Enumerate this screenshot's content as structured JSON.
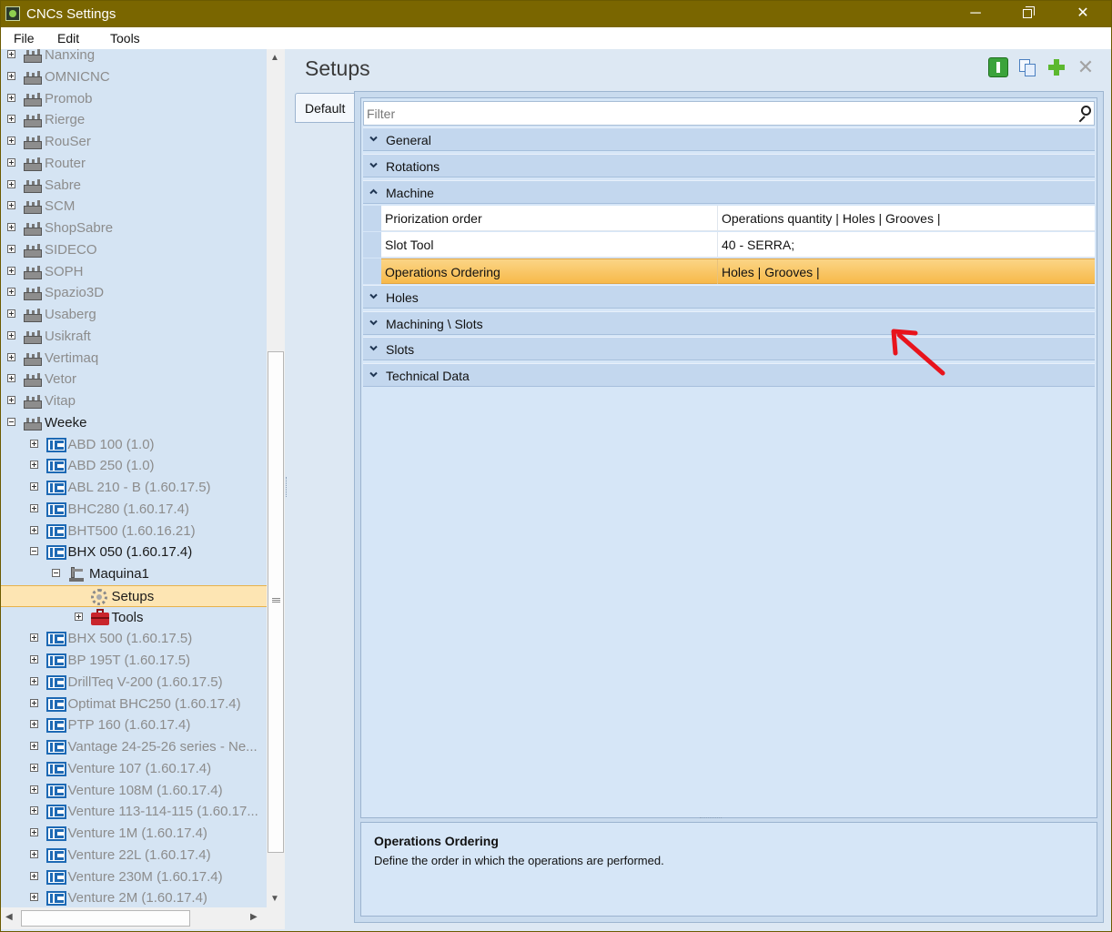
{
  "window": {
    "title": "CNCs Settings",
    "minimize": "─",
    "close": "✕"
  },
  "menu": [
    "File",
    "Edit",
    "Tools"
  ],
  "tree": [
    {
      "label": "Nanxing",
      "indent": 0,
      "icon": "factory",
      "expander": "plus",
      "style": "gray"
    },
    {
      "label": "OMNICNC",
      "indent": 0,
      "icon": "factory",
      "expander": "plus",
      "style": "gray"
    },
    {
      "label": "Promob",
      "indent": 0,
      "icon": "factory",
      "expander": "plus",
      "style": "gray"
    },
    {
      "label": "Rierge",
      "indent": 0,
      "icon": "factory",
      "expander": "plus",
      "style": "gray"
    },
    {
      "label": "RouSer",
      "indent": 0,
      "icon": "factory",
      "expander": "plus",
      "style": "gray"
    },
    {
      "label": "Router",
      "indent": 0,
      "icon": "factory",
      "expander": "plus",
      "style": "gray"
    },
    {
      "label": "Sabre",
      "indent": 0,
      "icon": "factory",
      "expander": "plus",
      "style": "gray"
    },
    {
      "label": "SCM",
      "indent": 0,
      "icon": "factory",
      "expander": "plus",
      "style": "gray"
    },
    {
      "label": "ShopSabre",
      "indent": 0,
      "icon": "factory",
      "expander": "plus",
      "style": "gray"
    },
    {
      "label": "SIDECO",
      "indent": 0,
      "icon": "factory",
      "expander": "plus",
      "style": "gray"
    },
    {
      "label": "SOPH",
      "indent": 0,
      "icon": "factory",
      "expander": "plus",
      "style": "gray"
    },
    {
      "label": "Spazio3D",
      "indent": 0,
      "icon": "factory",
      "expander": "plus",
      "style": "gray"
    },
    {
      "label": "Usaberg",
      "indent": 0,
      "icon": "factory",
      "expander": "plus",
      "style": "gray"
    },
    {
      "label": "Usikraft",
      "indent": 0,
      "icon": "factory",
      "expander": "plus",
      "style": "gray"
    },
    {
      "label": "Vertimaq",
      "indent": 0,
      "icon": "factory",
      "expander": "plus",
      "style": "gray"
    },
    {
      "label": "Vetor",
      "indent": 0,
      "icon": "factory",
      "expander": "plus",
      "style": "gray"
    },
    {
      "label": "Vitap",
      "indent": 0,
      "icon": "factory",
      "expander": "plus",
      "style": "gray"
    },
    {
      "label": "Weeke",
      "indent": 0,
      "icon": "factory",
      "expander": "minus",
      "style": "dark"
    },
    {
      "label": "ABD 100 (1.0)",
      "indent": 1,
      "icon": "hc",
      "expander": "plus",
      "style": "gray"
    },
    {
      "label": "ABD 250 (1.0)",
      "indent": 1,
      "icon": "hc",
      "expander": "plus",
      "style": "gray"
    },
    {
      "label": "ABL 210 - B (1.60.17.5)",
      "indent": 1,
      "icon": "hc",
      "expander": "plus",
      "style": "gray"
    },
    {
      "label": "BHC280 (1.60.17.4)",
      "indent": 1,
      "icon": "hc",
      "expander": "plus",
      "style": "gray"
    },
    {
      "label": "BHT500 (1.60.16.21)",
      "indent": 1,
      "icon": "hc",
      "expander": "plus",
      "style": "gray"
    },
    {
      "label": "BHX 050 (1.60.17.4)",
      "indent": 1,
      "icon": "hc",
      "expander": "minus",
      "style": "dark"
    },
    {
      "label": "Maquina1",
      "indent": 2,
      "icon": "machine",
      "expander": "minus",
      "style": "dark"
    },
    {
      "label": "Setups",
      "indent": 3,
      "icon": "gear",
      "expander": "none",
      "style": "dark",
      "selected": true
    },
    {
      "label": "Tools",
      "indent": 3,
      "icon": "toolbox",
      "expander": "plus",
      "style": "dark"
    },
    {
      "label": "BHX 500 (1.60.17.5)",
      "indent": 1,
      "icon": "hc",
      "expander": "plus",
      "style": "gray"
    },
    {
      "label": "BP 195T (1.60.17.5)",
      "indent": 1,
      "icon": "hc",
      "expander": "plus",
      "style": "gray"
    },
    {
      "label": "DrillTeq V-200 (1.60.17.5)",
      "indent": 1,
      "icon": "hc",
      "expander": "plus",
      "style": "gray"
    },
    {
      "label": "Optimat BHC250 (1.60.17.4)",
      "indent": 1,
      "icon": "hc",
      "expander": "plus",
      "style": "gray"
    },
    {
      "label": "PTP 160 (1.60.17.4)",
      "indent": 1,
      "icon": "hc",
      "expander": "plus",
      "style": "gray"
    },
    {
      "label": "Vantage 24-25-26 series - Ne...",
      "indent": 1,
      "icon": "hc",
      "expander": "plus",
      "style": "gray"
    },
    {
      "label": "Venture 107 (1.60.17.4)",
      "indent": 1,
      "icon": "hc",
      "expander": "plus",
      "style": "gray"
    },
    {
      "label": "Venture 108M (1.60.17.4)",
      "indent": 1,
      "icon": "hc",
      "expander": "plus",
      "style": "gray"
    },
    {
      "label": "Venture 113-114-115 (1.60.17...",
      "indent": 1,
      "icon": "hc",
      "expander": "plus",
      "style": "gray"
    },
    {
      "label": "Venture 1M (1.60.17.4)",
      "indent": 1,
      "icon": "hc",
      "expander": "plus",
      "style": "gray"
    },
    {
      "label": "Venture 22L (1.60.17.4)",
      "indent": 1,
      "icon": "hc",
      "expander": "plus",
      "style": "gray"
    },
    {
      "label": "Venture 230M (1.60.17.4)",
      "indent": 1,
      "icon": "hc",
      "expander": "plus",
      "style": "gray"
    },
    {
      "label": "Venture 2M (1.60.17.4)",
      "indent": 1,
      "icon": "hc",
      "expander": "plus",
      "style": "gray"
    }
  ],
  "header": {
    "title": "Setups"
  },
  "tabs": [
    {
      "label": "Default"
    }
  ],
  "filter": {
    "placeholder": "Filter",
    "value": ""
  },
  "grid": [
    {
      "kind": "category",
      "label": "General",
      "expanded": false
    },
    {
      "kind": "category",
      "label": "Rotations",
      "expanded": false
    },
    {
      "kind": "category",
      "label": "Machine",
      "expanded": true
    },
    {
      "kind": "property",
      "name": "Priorization order",
      "value": "Operations quantity | Holes | Grooves |"
    },
    {
      "kind": "property",
      "name": "Slot Tool",
      "value": "40 - SERRA;"
    },
    {
      "kind": "property",
      "name": "Operations Ordering",
      "value": "Holes | Grooves |",
      "selected": true
    },
    {
      "kind": "category",
      "label": "Holes",
      "expanded": false
    },
    {
      "kind": "category",
      "label": "Machining \\ Slots",
      "expanded": false
    },
    {
      "kind": "category",
      "label": "Slots",
      "expanded": false
    },
    {
      "kind": "category",
      "label": "Technical Data",
      "expanded": false
    }
  ],
  "description": {
    "title": "Operations Ordering",
    "text": "Define the order in which the operations are performed."
  },
  "colors": {
    "title_bar": "#7a6600",
    "selection": "#f7b94a",
    "tree_bg": "#d5e4f3",
    "category_bg": "#c3d7ee",
    "annotation_arrow": "#e8141c"
  }
}
